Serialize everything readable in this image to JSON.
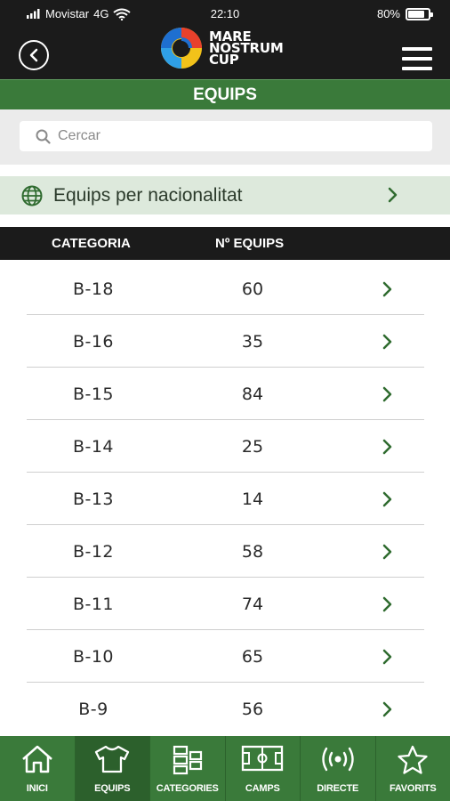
{
  "status": {
    "carrier": "Movistar",
    "network": "4G",
    "time": "22:10",
    "battery": "80%",
    "battery_level": 0.8
  },
  "header": {
    "logo_lines": [
      "MARE",
      "NOSTRUM",
      "CUP"
    ]
  },
  "section": {
    "title": "EQUIPS"
  },
  "search": {
    "placeholder": "Cercar"
  },
  "nationality": {
    "label": "Equips per nacionalitat"
  },
  "table": {
    "headers": {
      "category": "CATEGORIA",
      "teams": "Nº EQUIPS"
    },
    "rows": [
      {
        "category": "B-18",
        "teams": "60"
      },
      {
        "category": "B-16",
        "teams": "35"
      },
      {
        "category": "B-15",
        "teams": "84"
      },
      {
        "category": "B-14",
        "teams": "25"
      },
      {
        "category": "B-13",
        "teams": "14"
      },
      {
        "category": "B-12",
        "teams": "58"
      },
      {
        "category": "B-11",
        "teams": "74"
      },
      {
        "category": "B-10",
        "teams": "65"
      },
      {
        "category": "B-9",
        "teams": "56"
      }
    ]
  },
  "tabs": [
    {
      "label": "INICI",
      "icon": "home-icon"
    },
    {
      "label": "EQUIPS",
      "icon": "shirt-icon",
      "active": true
    },
    {
      "label": "CATEGORIES",
      "icon": "categories-icon"
    },
    {
      "label": "CAMPS",
      "icon": "field-icon"
    },
    {
      "label": "DIRECTE",
      "icon": "broadcast-icon"
    },
    {
      "label": "FAVORITS",
      "icon": "star-icon"
    }
  ],
  "colors": {
    "green": "#3a7a3a",
    "dark": "#1b1b1b",
    "light_green": "#dde9dc"
  }
}
